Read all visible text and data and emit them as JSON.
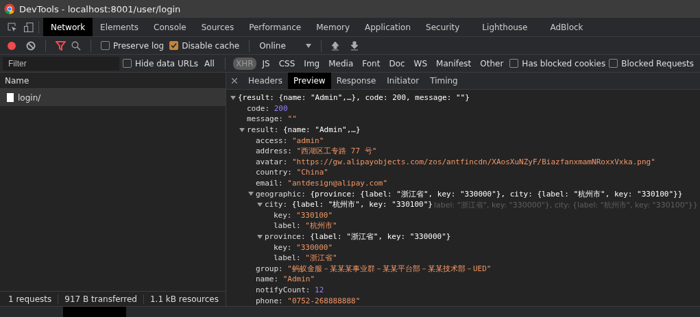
{
  "window": {
    "title": "DevTools - localhost:8001/user/login"
  },
  "panel_tabs": [
    {
      "label": "Network",
      "selected": true
    },
    {
      "label": "Elements",
      "selected": false
    },
    {
      "label": "Console",
      "selected": false
    },
    {
      "label": "Sources",
      "selected": false
    },
    {
      "label": "Performance",
      "selected": false
    },
    {
      "label": "Memory",
      "selected": false
    },
    {
      "label": "Application",
      "selected": false
    },
    {
      "label": "Security",
      "selected": false
    },
    {
      "label": "Lighthouse",
      "selected": false
    },
    {
      "label": "AdBlock",
      "selected": false
    }
  ],
  "toolbar": {
    "recording": true,
    "filter_active": true,
    "preserve_log": {
      "label": "Preserve log",
      "checked": false
    },
    "disable_cache": {
      "label": "Disable cache",
      "checked": true
    },
    "throttling": "Online"
  },
  "filter_bar": {
    "placeholder": "Filter",
    "hide_data_urls": {
      "label": "Hide data URLs",
      "checked": false
    },
    "types": [
      {
        "label": "All",
        "selected": false
      },
      {
        "label": "XHR",
        "selected": true
      },
      {
        "label": "JS",
        "selected": false
      },
      {
        "label": "CSS",
        "selected": false
      },
      {
        "label": "Img",
        "selected": false
      },
      {
        "label": "Media",
        "selected": false
      },
      {
        "label": "Font",
        "selected": false
      },
      {
        "label": "Doc",
        "selected": false
      },
      {
        "label": "WS",
        "selected": false
      },
      {
        "label": "Manifest",
        "selected": false
      },
      {
        "label": "Other",
        "selected": false
      }
    ],
    "has_blocked_cookies": {
      "label": "Has blocked cookies",
      "checked": false
    },
    "blocked_requests": {
      "label": "Blocked Requests",
      "checked": false
    }
  },
  "requests": {
    "column": "Name",
    "rows": [
      {
        "name": "login/",
        "selected": true
      }
    ]
  },
  "status_bar": [
    "1 requests",
    "917 B transferred",
    "1.1 kB resources"
  ],
  "detail_tabs": [
    {
      "label": "Headers",
      "selected": false
    },
    {
      "label": "Preview",
      "selected": true
    },
    {
      "label": "Response",
      "selected": false
    },
    {
      "label": "Initiator",
      "selected": false
    },
    {
      "label": "Timing",
      "selected": false
    }
  ],
  "preview": [
    {
      "kind": "object",
      "summary": "{result: {name: \"Admin\",…}, code: 200, message: \"\"}",
      "expanded": true,
      "children": [
        {
          "kind": "number",
          "key": "code:",
          "value": "200"
        },
        {
          "kind": "string",
          "key": "message:",
          "value": "\"\""
        },
        {
          "kind": "object",
          "key": "result:",
          "summary": "{name: \"Admin\",…}",
          "expanded": true,
          "children": [
            {
              "kind": "string",
              "key": "access:",
              "value": "\"admin\""
            },
            {
              "kind": "string",
              "key": "address:",
              "value": "\"西湖区工专路 77 号\""
            },
            {
              "kind": "string",
              "key": "avatar:",
              "value": "\"https://gw.alipayobjects.com/zos/antfincdn/XAosXuNZyF/BiazfanxmamNRoxxVxka.png\""
            },
            {
              "kind": "string",
              "key": "country:",
              "value": "\"China\""
            },
            {
              "kind": "string",
              "key": "email:",
              "value": "\"antdesign@alipay.com\""
            },
            {
              "kind": "object",
              "key": "geographic:",
              "summary": "{province: {label: \"浙江省\", key: \"330000\"}, city: {label: \"杭州市\", key: \"330100\"}}",
              "expanded": true,
              "children": [
                {
                  "kind": "object",
                  "key": "city:",
                  "summary": "{label: \"杭州市\", key: \"330100\"}",
                  "expanded": true,
                  "tooltip": "label: \"浙江省\", key: \"330000\"}, city: {label: \"杭州市\", key: \"330100\"}}",
                  "children": [
                    {
                      "kind": "string",
                      "key": "key:",
                      "value": "\"330100\""
                    },
                    {
                      "kind": "string",
                      "key": "label:",
                      "value": "\"杭州市\""
                    }
                  ]
                },
                {
                  "kind": "object",
                  "key": "province:",
                  "summary": "{label: \"浙江省\", key: \"330000\"}",
                  "expanded": true,
                  "children": [
                    {
                      "kind": "string",
                      "key": "key:",
                      "value": "\"330000\""
                    },
                    {
                      "kind": "string",
                      "key": "label:",
                      "value": "\"浙江省\""
                    }
                  ]
                }
              ]
            },
            {
              "kind": "string",
              "key": "group:",
              "value": "\"蚂蚁金服－某某某事业群－某某平台部－某某技术部－UED\""
            },
            {
              "kind": "string",
              "key": "name:",
              "value": "\"Admin\""
            },
            {
              "kind": "number",
              "key": "notifyCount:",
              "value": "12"
            },
            {
              "kind": "string",
              "key": "phone:",
              "value": "\"0752-268888888\""
            }
          ]
        }
      ]
    }
  ]
}
